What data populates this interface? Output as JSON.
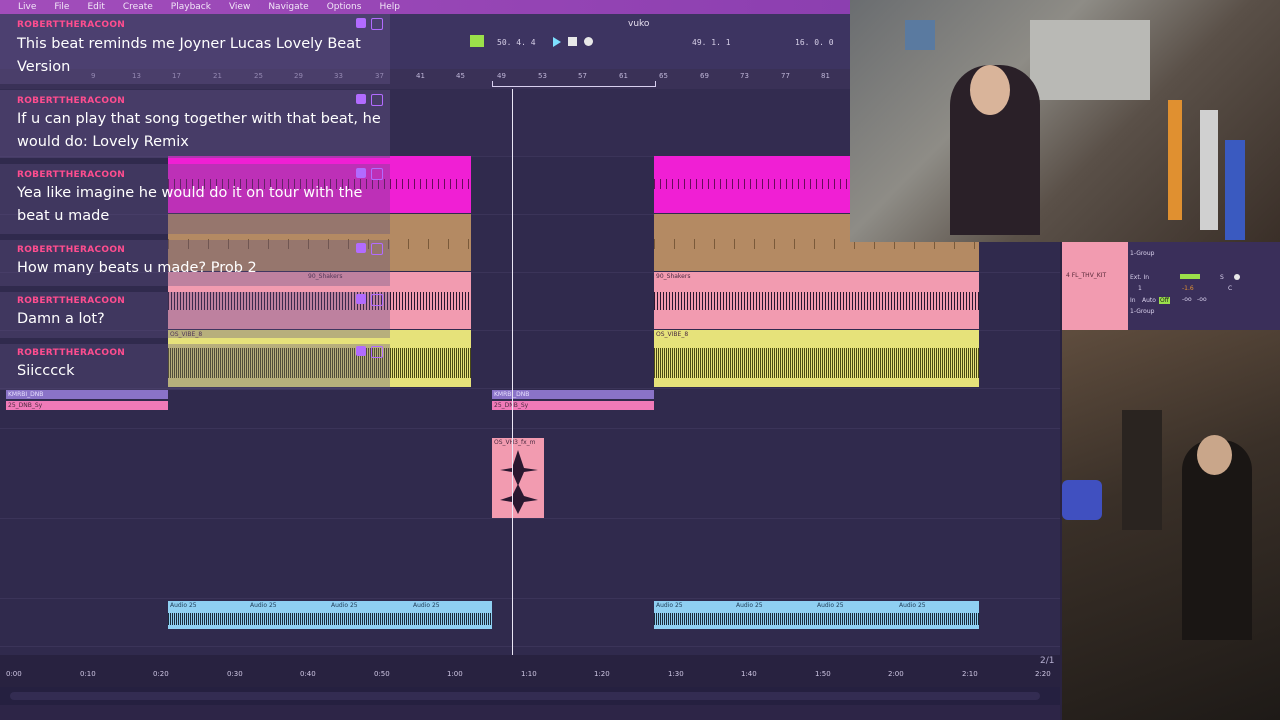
{
  "menu": {
    "items": [
      "Live",
      "File",
      "Edit",
      "Create",
      "Playback",
      "View",
      "Navigate",
      "Options",
      "Help"
    ]
  },
  "transport": {
    "title": "vuko",
    "tempo_display": "50. 4. 4",
    "position_display": "49. 1. 1",
    "end_display": "16. 0. 0"
  },
  "ruler": {
    "bars": [
      "9",
      "13",
      "17",
      "21",
      "25",
      "29",
      "33",
      "37",
      "41",
      "45",
      "49",
      "53",
      "57",
      "61",
      "65",
      "69",
      "73",
      "77",
      "81"
    ]
  },
  "timeline": {
    "ticks": [
      "0:00",
      "0:10",
      "0:20",
      "0:30",
      "0:40",
      "0:50",
      "1:00",
      "1:10",
      "1:20",
      "1:30",
      "1:40",
      "1:50",
      "2:00",
      "2:10",
      "2:20"
    ]
  },
  "page_count": "2/1",
  "chat": {
    "messages": [
      {
        "user": "ROBERTTHERACOON",
        "text": "This beat reminds me Joyner Lucas Lovely Beat Version"
      },
      {
        "user": "ROBERTTHERACOON",
        "text": "If u can play that song together with that beat, he would do: Lovely Remix"
      },
      {
        "user": "ROBERTTHERACOON",
        "text": "Yea like imagine he would do it on tour with the beat u made"
      },
      {
        "user": "ROBERTTHERACOON",
        "text": "How many beats u made? Prob 2"
      },
      {
        "user": "ROBERTTHERACOON",
        "text": "Damn a lot?"
      },
      {
        "user": "ROBERTTHERACOON",
        "text": "Siicccck"
      }
    ]
  },
  "clips": {
    "shakers": "90_Shakers",
    "vibe": "OS_VIBE_8",
    "kmrbi": "KMRBI_DNB",
    "dnb": "25_DNB_Sy",
    "fx": "OS_VH3_fx_m",
    "audio": "Audio 25"
  },
  "mixer": {
    "track_name": "4 FL_THV_KIT",
    "group1": "1-Group",
    "group2": "1-Group",
    "input": "Ext. In",
    "channel": "1",
    "mode_in": "In",
    "mode_auto": "Auto",
    "mode_off": "Off",
    "send_s": "S",
    "send_c": "C",
    "inf1": "-oo",
    "inf2": "-oo",
    "vol": "-1.6"
  },
  "colors": {
    "magenta": "#f01fd4",
    "pink_wave": "#f29bb0",
    "yellow": "#e6e27a",
    "blue": "#8fcff2",
    "username": "#ff4d8f"
  }
}
